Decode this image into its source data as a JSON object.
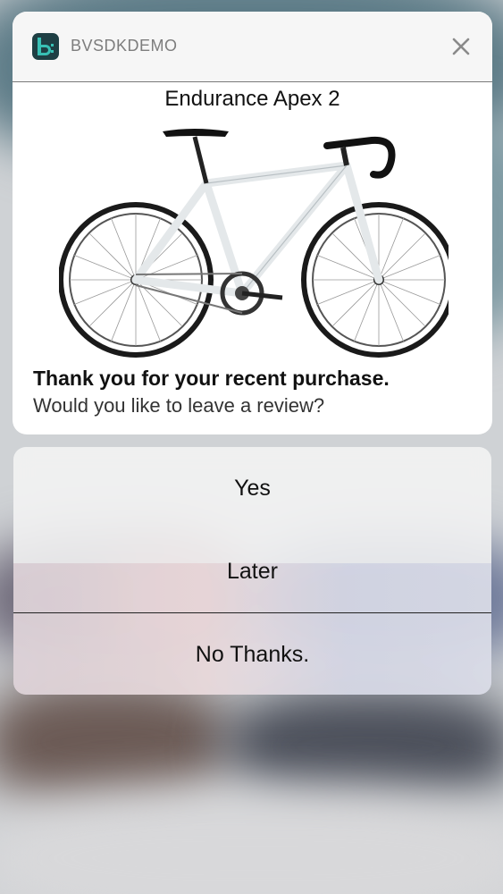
{
  "notification": {
    "app_name": "BVSDKDEMO",
    "product_title": "Endurance Apex 2",
    "message_bold": "Thank you for your recent purchase.",
    "message": "Would you like to leave a review?",
    "icons": {
      "app": "bvsdk-app-icon",
      "close": "close-icon",
      "product": "road-bike-image"
    }
  },
  "actions": {
    "yes": "Yes",
    "later": "Later",
    "no_thanks": "No Thanks."
  },
  "colors": {
    "app_icon_bg": "#1e3f44",
    "app_icon_fg": "#38c0b5"
  }
}
